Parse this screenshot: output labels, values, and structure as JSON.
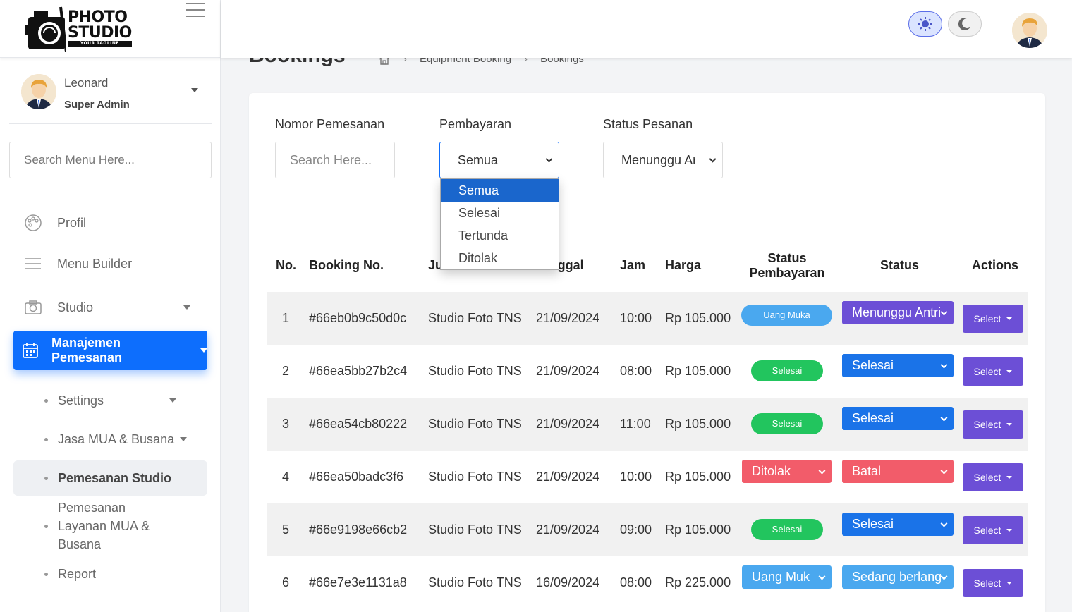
{
  "logo": {
    "line1": "PHOTO",
    "line2": "STUDIO",
    "tagline": "YOUR TAGLINE"
  },
  "user": {
    "name": "Leonard",
    "role": "Super Admin"
  },
  "menu_search": {
    "placeholder": "Search Menu Here..."
  },
  "menu": {
    "profil": "Profil",
    "menu_builder": "Menu Builder",
    "studio": "Studio",
    "manajemen": "Manajemen Pemesanan",
    "sub": {
      "settings": "Settings",
      "jasa": "Jasa MUA & Busana",
      "pemesanan_studio": "Pemesanan Studio",
      "pemesanan_layanan": "Pemesanan Layanan MUA & Busana",
      "report": "Report"
    }
  },
  "page": {
    "title": "Bookings"
  },
  "breadcrumb": [
    "Equipment Booking",
    "Bookings"
  ],
  "filters": {
    "nomor_label": "Nomor Pemesanan",
    "nomor_placeholder": "Search Here...",
    "pembayaran_label": "Pembayaran",
    "pembayaran_value": "Semua",
    "status_label": "Status Pesanan",
    "status_value": "Menunggu Antrian",
    "pembayaran_options": [
      "Semua",
      "Selesai",
      "Tertunda",
      "Ditolak"
    ]
  },
  "table": {
    "headers": {
      "no": "No.",
      "booking": "Booking No.",
      "judul": "Judul",
      "tanggal": "Tanggal",
      "jam": "Jam",
      "harga": "Harga",
      "status_bayar_1": "Status",
      "status_bayar_2": "Pembayaran",
      "status": "Status",
      "actions": "Actions"
    },
    "rows": [
      {
        "no": "1",
        "booking": "#66eb0b9c50d0c",
        "judul": "Studio Foto TNS",
        "tanggal": "21/09/2024",
        "jam": "10:00",
        "harga": "Rp 105.000",
        "pay": "Uang Muka",
        "status": "Menunggu Antrian",
        "action": "Select"
      },
      {
        "no": "2",
        "booking": "#66ea5bb27b2c4",
        "judul": "Studio Foto TNS",
        "tanggal": "21/09/2024",
        "jam": "08:00",
        "harga": "Rp 105.000",
        "pay": "Selesai",
        "status": "Selesai",
        "action": "Select"
      },
      {
        "no": "3",
        "booking": "#66ea54cb80222",
        "judul": "Studio Foto TNS",
        "tanggal": "21/09/2024",
        "jam": "11:00",
        "harga": "Rp 105.000",
        "pay": "Selesai",
        "status": "Selesai",
        "action": "Select"
      },
      {
        "no": "4",
        "booking": "#66ea50badc3f6",
        "judul": "Studio Foto TNS",
        "tanggal": "21/09/2024",
        "jam": "10:00",
        "harga": "Rp 105.000",
        "pay": "Ditolak",
        "status": "Batal",
        "action": "Select"
      },
      {
        "no": "5",
        "booking": "#66e9198e66cb2",
        "judul": "Studio Foto TNS",
        "tanggal": "21/09/2024",
        "jam": "09:00",
        "harga": "Rp 105.000",
        "pay": "Selesai",
        "status": "Selesai",
        "action": "Select"
      },
      {
        "no": "6",
        "booking": "#66e7e3e1131a8",
        "judul": "Studio Foto TNS",
        "tanggal": "16/09/2024",
        "jam": "08:00",
        "harga": "Rp 225.000",
        "pay": "Uang Muka",
        "status": "Sedang berlangsung",
        "action": "Select"
      }
    ]
  },
  "colors": {
    "primary": "#0d6efd",
    "green": "#22c55e",
    "light_blue": "#4aa8ef",
    "red": "#f25c6a",
    "purple": "#6c4fd6",
    "select_blue": "#1a73e8",
    "status_purple": "#6c4fd6"
  }
}
